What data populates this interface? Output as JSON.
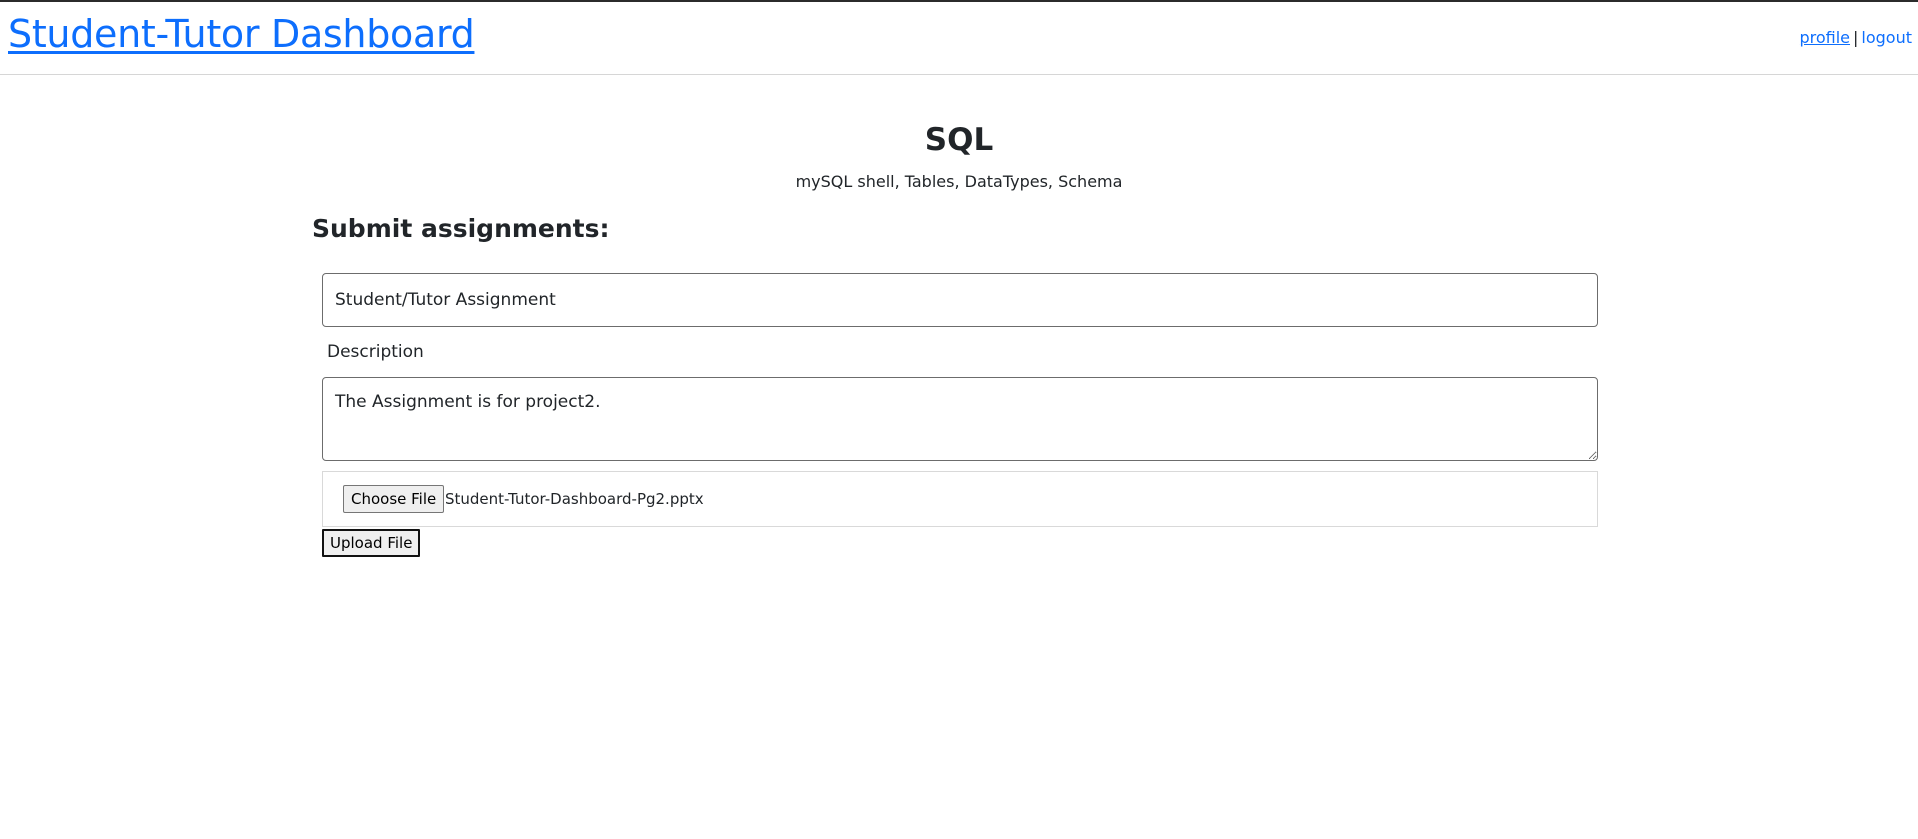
{
  "header": {
    "title": "Student-Tutor Dashboard",
    "links": {
      "profile": "profile",
      "separator": "|",
      "logout": "logout"
    }
  },
  "course": {
    "title": "SQL",
    "topics": "mySQL shell, Tables, DataTypes, Schema"
  },
  "submission": {
    "heading": "Submit assignments:",
    "title_value": "Student/Tutor Assignment",
    "description_label": "Description",
    "description_value": "The Assignment is for project2.",
    "choose_file_label": "Choose File",
    "file_name": "Student-Tutor-Dashboard-Pg2.pptx",
    "upload_label": "Upload File"
  },
  "colors": {
    "link": "#0d6efd",
    "text": "#212529",
    "border": "#6c6c6c"
  }
}
